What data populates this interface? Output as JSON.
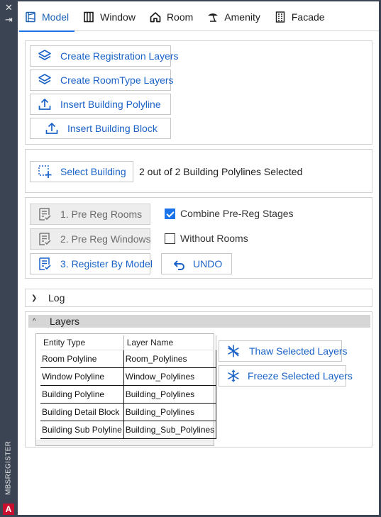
{
  "window": {
    "vertical_title": "MBSREGISTER",
    "close_glyph": "✕",
    "pin_glyph": "⇥",
    "logo_letter": "A"
  },
  "tabs": [
    {
      "label": "Model",
      "icon": "model-icon",
      "active": true
    },
    {
      "label": "Window",
      "icon": "window-icon",
      "active": false
    },
    {
      "label": "Room",
      "icon": "room-icon",
      "active": false
    },
    {
      "label": "Amenity",
      "icon": "amenity-icon",
      "active": false
    },
    {
      "label": "Facade",
      "icon": "facade-icon",
      "active": false
    }
  ],
  "layer_tools": {
    "create_registration": "Create Registration Layers",
    "create_roomtype": "Create RoomType Layers",
    "insert_polyline": "Insert Building Polyline",
    "insert_block": "Insert Building Block"
  },
  "selection": {
    "select_button": "Select Building",
    "status": "2 out of 2 Building Polylines Selected"
  },
  "register": {
    "pre_reg_rooms": "1. Pre Reg Rooms",
    "pre_reg_windows": "2. Pre Reg Windows",
    "register_by_model": "3. Register By Model",
    "combine_label": "Combine Pre-Reg Stages",
    "combine_checked": true,
    "without_rooms_label": "Without Rooms",
    "without_rooms_checked": false,
    "undo": "UNDO"
  },
  "log": {
    "title": "Log"
  },
  "layers": {
    "title": "Layers",
    "columns": [
      "Entity Type",
      "Layer Name"
    ],
    "rows": [
      [
        "Room Polyline",
        "Room_Polylines"
      ],
      [
        "Window Polyline",
        "Window_Polylines"
      ],
      [
        "Building Polyline",
        "Building_Polylines"
      ],
      [
        "Building Detail Block",
        "Building_Polylines"
      ],
      [
        "Building Sub Polyline",
        "Building_Sub_Polylines"
      ]
    ],
    "thaw_button": "Thaw Selected Layers",
    "freeze_button": "Freeze Selected Layers"
  },
  "colors": {
    "accent": "#1a73e8",
    "button_text": "#1a62c7",
    "side_strip": "#3b4453"
  }
}
